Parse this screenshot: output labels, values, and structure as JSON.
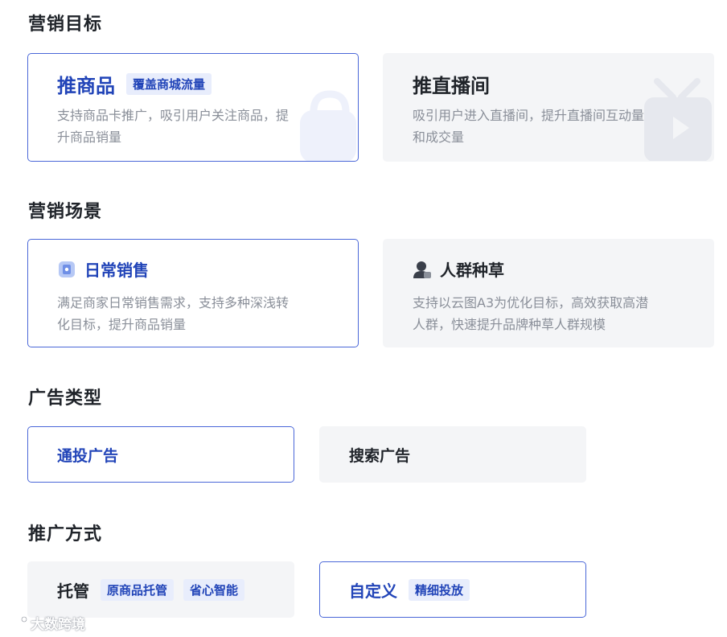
{
  "sections": {
    "goal": "营销目标",
    "scene": "营销场景",
    "ad_type": "广告类型",
    "method": "推广方式"
  },
  "goal_cards": [
    {
      "title": "推商品",
      "tag": "覆盖商城流量",
      "desc_line1": "支持商品卡推广，吸引用户关注商品，提",
      "desc_line2": "升商品销量",
      "selected": true
    },
    {
      "title": "推直播间",
      "desc_line1": "吸引用户进入直播间，提升直播间互动量",
      "desc_line2": "和成交量",
      "selected": false
    }
  ],
  "scene_cards": [
    {
      "title": "日常销售",
      "icon": "sales-doc-icon",
      "desc_line1": "满足商家日常销售需求，支持多种深浅转",
      "desc_line2": "化目标，提升商品销量",
      "selected": true
    },
    {
      "title": "人群种草",
      "icon": "person-icon",
      "desc_line1": "支持以云图A3为优化目标，高效获取高潜",
      "desc_line2": "人群，快速提升品牌种草人群规模",
      "selected": false
    }
  ],
  "ad_types": [
    {
      "label": "通投广告",
      "selected": true
    },
    {
      "label": "搜索广告",
      "selected": false
    }
  ],
  "methods": [
    {
      "label": "托管",
      "tags": [
        "原商品托管",
        "省心智能"
      ],
      "selected": false
    },
    {
      "label": "自定义",
      "tags": [
        "精细投放"
      ],
      "selected": true
    }
  ],
  "watermark": "大数跨境",
  "colors": {
    "accent": "#2144b8",
    "border": "#4a67d8",
    "tag_bg": "#e8edfc",
    "card_bg": "#f4f5f7"
  }
}
